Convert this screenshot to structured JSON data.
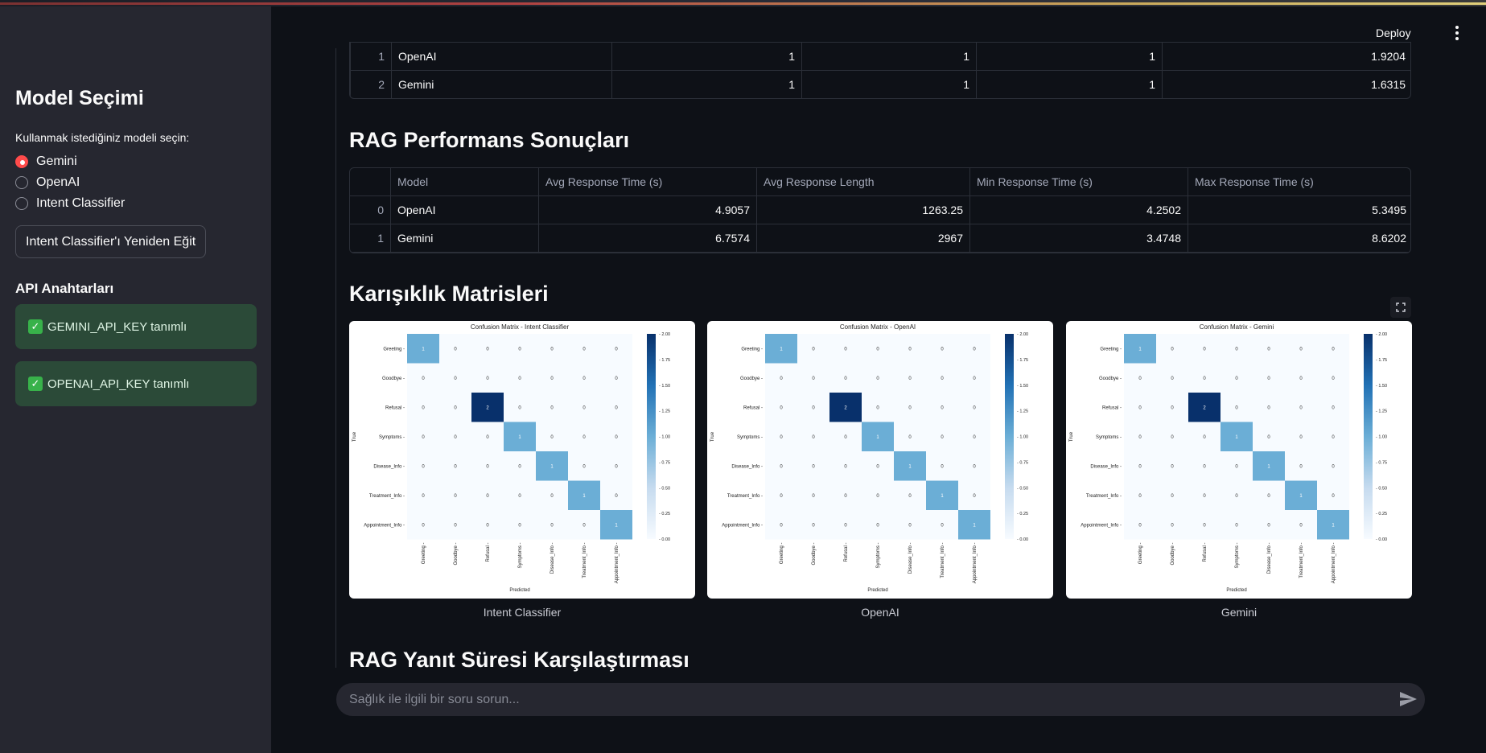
{
  "header": {
    "deploy_label": "Deploy"
  },
  "sidebar": {
    "title": "Model Seçimi",
    "radio_label": "Kullanmak istediğiniz modeli seçin:",
    "options": [
      "Gemini",
      "OpenAI",
      "Intent Classifier"
    ],
    "selected": "Gemini",
    "retrain_button": "Intent Classifier'ı Yeniden Eğit",
    "api_title": "API Anahtarları",
    "api_alerts": [
      "GEMINI_API_KEY tanımlı",
      "OPENAI_API_KEY tanımlı"
    ]
  },
  "top_table": {
    "rows": [
      {
        "index": "1",
        "model": "OpenAI",
        "c1": "1",
        "c2": "1",
        "c3": "1",
        "c4": "1.9204"
      },
      {
        "index": "2",
        "model": "Gemini",
        "c1": "1",
        "c2": "1",
        "c3": "1",
        "c4": "1.6315"
      }
    ]
  },
  "rag": {
    "title": "RAG Performans Sonuçları",
    "columns": [
      "Model",
      "Avg Response Time (s)",
      "Avg Response Length",
      "Min Response Time (s)",
      "Max Response Time (s)"
    ],
    "rows": [
      {
        "index": "0",
        "model": "OpenAI",
        "avg_time": "4.9057",
        "avg_len": "1263.25",
        "min_time": "4.2502",
        "max_time": "5.3495"
      },
      {
        "index": "1",
        "model": "Gemini",
        "avg_time": "6.7574",
        "avg_len": "2967",
        "min_time": "3.4748",
        "max_time": "8.6202"
      }
    ]
  },
  "matrices": {
    "title": "Karışıklık Matrisleri",
    "labels": [
      "Greeting",
      "Goodbye",
      "Refusal",
      "Symptoms",
      "Disease_Info",
      "Treatment_Info",
      "Appointment_Info"
    ],
    "xlabel": "Predicted",
    "ylabel": "True",
    "colorbar_ticks": [
      "2.00",
      "1.75",
      "1.50",
      "1.25",
      "1.00",
      "0.75",
      "0.50",
      "0.25",
      "0.00"
    ],
    "colors": {
      "dark": "#08306b",
      "mid": "#6baed6",
      "light": "#f7fbff"
    },
    "charts": [
      {
        "title": "Confusion Matrix - Intent Classifier",
        "caption": "Intent Classifier",
        "diagonal": [
          1,
          0,
          2,
          1,
          1,
          1,
          1
        ]
      },
      {
        "title": "Confusion Matrix - OpenAI",
        "caption": "OpenAI",
        "diagonal": [
          1,
          0,
          2,
          1,
          1,
          1,
          1
        ]
      },
      {
        "title": "Confusion Matrix - Gemini",
        "caption": "Gemini",
        "diagonal": [
          1,
          0,
          2,
          1,
          1,
          1,
          1
        ]
      }
    ]
  },
  "chart_data": [
    {
      "type": "heatmap",
      "title": "Confusion Matrix - Intent Classifier",
      "xlabel": "Predicted",
      "ylabel": "True",
      "categories": [
        "Greeting",
        "Goodbye",
        "Refusal",
        "Symptoms",
        "Disease_Info",
        "Treatment_Info",
        "Appointment_Info"
      ],
      "values": [
        [
          1,
          0,
          0,
          0,
          0,
          0,
          0
        ],
        [
          0,
          0,
          0,
          0,
          0,
          0,
          0
        ],
        [
          0,
          0,
          2,
          0,
          0,
          0,
          0
        ],
        [
          0,
          0,
          0,
          1,
          0,
          0,
          0
        ],
        [
          0,
          0,
          0,
          0,
          1,
          0,
          0
        ],
        [
          0,
          0,
          0,
          0,
          0,
          1,
          0
        ],
        [
          0,
          0,
          0,
          0,
          0,
          0,
          1
        ]
      ],
      "colorbar_range": [
        0,
        2
      ]
    },
    {
      "type": "heatmap",
      "title": "Confusion Matrix - OpenAI",
      "xlabel": "Predicted",
      "ylabel": "True",
      "categories": [
        "Greeting",
        "Goodbye",
        "Refusal",
        "Symptoms",
        "Disease_Info",
        "Treatment_Info",
        "Appointment_Info"
      ],
      "values": [
        [
          1,
          0,
          0,
          0,
          0,
          0,
          0
        ],
        [
          0,
          0,
          0,
          0,
          0,
          0,
          0
        ],
        [
          0,
          0,
          2,
          0,
          0,
          0,
          0
        ],
        [
          0,
          0,
          0,
          1,
          0,
          0,
          0
        ],
        [
          0,
          0,
          0,
          0,
          1,
          0,
          0
        ],
        [
          0,
          0,
          0,
          0,
          0,
          1,
          0
        ],
        [
          0,
          0,
          0,
          0,
          0,
          0,
          1
        ]
      ],
      "colorbar_range": [
        0,
        2
      ]
    },
    {
      "type": "heatmap",
      "title": "Confusion Matrix - Gemini",
      "xlabel": "Predicted",
      "ylabel": "True",
      "categories": [
        "Greeting",
        "Goodbye",
        "Refusal",
        "Symptoms",
        "Disease_Info",
        "Treatment_Info",
        "Appointment_Info"
      ],
      "values": [
        [
          1,
          0,
          0,
          0,
          0,
          0,
          0
        ],
        [
          0,
          0,
          0,
          0,
          0,
          0,
          0
        ],
        [
          0,
          0,
          2,
          0,
          0,
          0,
          0
        ],
        [
          0,
          0,
          0,
          1,
          0,
          0,
          0
        ],
        [
          0,
          0,
          0,
          0,
          1,
          0,
          0
        ],
        [
          0,
          0,
          0,
          0,
          0,
          1,
          0
        ],
        [
          0,
          0,
          0,
          0,
          0,
          0,
          1
        ]
      ],
      "colorbar_range": [
        0,
        2
      ]
    }
  ],
  "next_section": {
    "title": "RAG Yanıt Süresi Karşılaştırması"
  },
  "chat": {
    "placeholder": "Sağlık ile ilgili bir soru sorun..."
  }
}
